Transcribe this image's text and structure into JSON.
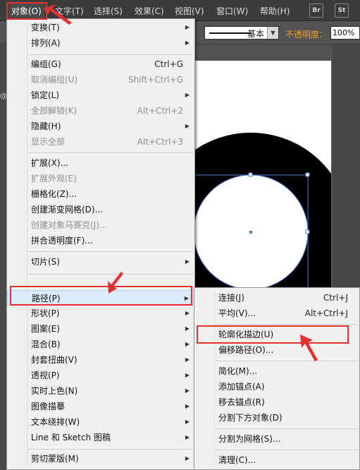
{
  "menubar": {
    "items": [
      "对象(O)",
      "文字(T)",
      "选择(S)",
      "效果(C)",
      "视图(V)",
      "窗口(W)",
      "帮助(H)"
    ],
    "app_buttons": [
      "Br",
      "St"
    ]
  },
  "controlbar": {
    "stroke_profile": "基本",
    "opacity_label": "不透明度：",
    "opacity_value": "100%",
    "doc_tab_stub": "@"
  },
  "main_menu": {
    "items": [
      {
        "label": "变换(T)",
        "submenu": true
      },
      {
        "label": "排列(A)",
        "submenu": true
      },
      {
        "label": "编组(G)",
        "shortcut": "Ctrl+G"
      },
      {
        "label": "取消编组(U)",
        "shortcut": "Shift+Ctrl+G",
        "disabled": true
      },
      {
        "label": "锁定(L)",
        "submenu": true
      },
      {
        "label": "全部解锁(K)",
        "shortcut": "Alt+Ctrl+2",
        "disabled": true
      },
      {
        "label": "隐藏(H)",
        "submenu": true
      },
      {
        "label": "显示全部",
        "shortcut": "Alt+Ctrl+3",
        "disabled": true
      },
      {
        "label": "扩展(X)..."
      },
      {
        "label": "扩展外观(E)",
        "disabled": true
      },
      {
        "label": "栅格化(Z)..."
      },
      {
        "label": "创建渐变网格(D)..."
      },
      {
        "label": "创建对象马赛克(J)...",
        "disabled": true
      },
      {
        "label": "拼合透明度(F)..."
      },
      {
        "label": "切片(S)",
        "submenu": true
      },
      {
        "label": "路径(P)",
        "submenu": true,
        "highlighted": true
      },
      {
        "label": "形状(P)",
        "submenu": true
      },
      {
        "label": "图案(E)",
        "submenu": true
      },
      {
        "label": "混合(B)",
        "submenu": true
      },
      {
        "label": "封套扭曲(V)",
        "submenu": true
      },
      {
        "label": "透视(P)",
        "submenu": true
      },
      {
        "label": "实时上色(N)",
        "submenu": true
      },
      {
        "label": "图像描摹",
        "submenu": true
      },
      {
        "label": "文本绕排(W)",
        "submenu": true
      },
      {
        "label": "Line 和 Sketch 图稿",
        "submenu": true
      },
      {
        "label": "剪切蒙版(M)",
        "submenu": true
      }
    ]
  },
  "sub_menu": {
    "items": [
      {
        "label": "连接(J)",
        "shortcut": "Ctrl+J"
      },
      {
        "label": "平均(V)...",
        "shortcut": "Alt+Ctrl+J"
      },
      {
        "label": "轮廓化描边(U)"
      },
      {
        "label": "偏移路径(O)..."
      },
      {
        "label": "简化(M)..."
      },
      {
        "label": "添加锚点(A)"
      },
      {
        "label": "移去锚点(R)"
      },
      {
        "label": "分割下方对象(D)"
      },
      {
        "label": "分割为网格(S)..."
      },
      {
        "label": "清理(C)..."
      }
    ]
  },
  "colors": {
    "annotation": "#e53030",
    "selection": "#4a7bd4",
    "highlight": "#dcebfb"
  },
  "icons": {
    "submenu_arrow": "triangle-right-icon",
    "stroke_dropdown": "chevron-down-icon"
  }
}
